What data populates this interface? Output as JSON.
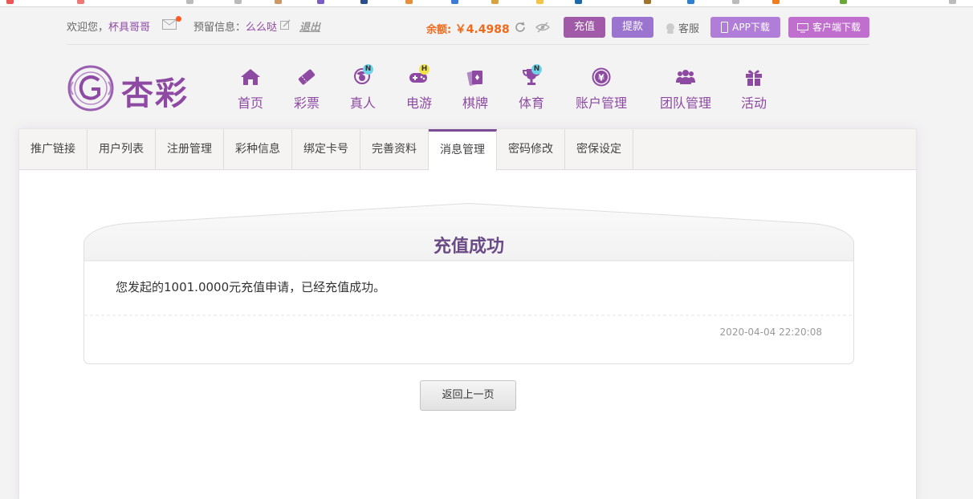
{
  "topbar": {
    "welcome_prefix": "欢迎您，",
    "username": "杯具哥哥",
    "reserved_label": "预留信息：",
    "reserved_value": "么么哒",
    "logout": "退出",
    "balance_label": "余额:",
    "balance_value": "￥4.4988",
    "recharge": "充值",
    "withdraw": "提款",
    "customer_service": "客服",
    "app_download": "APP下载",
    "client_download": "客户端下载"
  },
  "logo": {
    "text": "杏彩"
  },
  "nav": [
    {
      "label": "首页",
      "icon": "home-icon"
    },
    {
      "label": "彩票",
      "icon": "ticket-icon"
    },
    {
      "label": "真人",
      "icon": "dealer-icon",
      "badge": "N"
    },
    {
      "label": "电游",
      "icon": "gamepad-icon",
      "badge": "H"
    },
    {
      "label": "棋牌",
      "icon": "cards-icon"
    },
    {
      "label": "体育",
      "icon": "trophy-icon",
      "badge": "N"
    },
    {
      "label": "账户管理",
      "icon": "yen-coin-icon"
    },
    {
      "label": "团队管理",
      "icon": "team-icon"
    },
    {
      "label": "活动",
      "icon": "gift-icon"
    }
  ],
  "tabs": [
    "推广链接",
    "用户列表",
    "注册管理",
    "彩种信息",
    "绑定卡号",
    "完善资料",
    "消息管理",
    "密码修改",
    "密保设定"
  ],
  "active_tab": "消息管理",
  "message": {
    "title": "充值成功",
    "body": "您发起的1001.0000元充值申请，已经充值成功。",
    "time": "2020-04-04 22:20:08"
  },
  "back_button": "返回上一页",
  "colors": {
    "brand_purple": "#8e4aa3",
    "balance_orange": "#ef6a1b",
    "recharge_btn": "#a05aa7",
    "withdraw_btn": "#9b74cf"
  }
}
